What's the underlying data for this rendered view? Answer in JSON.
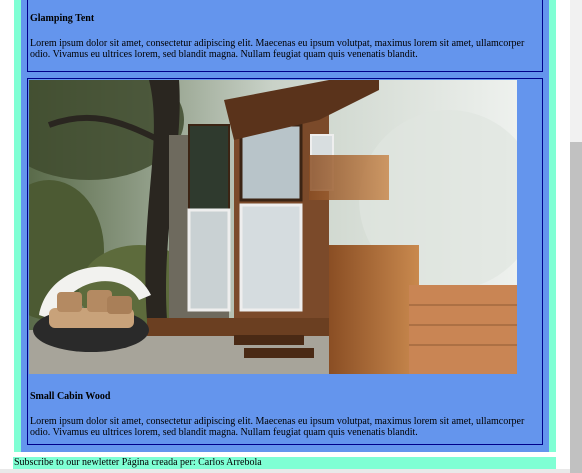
{
  "cards": [
    {
      "title": "Glamping Tent",
      "text": "Lorem ipsum dolor sit amet, consectetur adipiscing elit. Maecenas eu ipsum volutpat, maximus lorem sit amet, ullamcorper odio. Vivamus eu ultrices lorem, sed blandit magna. Nullam feugiat quam quis venenatis blandit."
    },
    {
      "title": "Small Cabin Wood",
      "text": "Lorem ipsum dolor sit amet, consectetur adipiscing elit. Maecenas eu ipsum volutpat, maximus lorem sit amet, ullamcorper odio. Vivamus eu ultrices lorem, sed blandit magna. Nullam feugiat quam quis venenatis blandit."
    }
  ],
  "footer": {
    "text": "Subscribe to our newletter Página creada per: Carlos Arrebola"
  },
  "colors": {
    "frame": "#7fffd4",
    "column": "#6495ed",
    "card_border": "#00008b"
  }
}
